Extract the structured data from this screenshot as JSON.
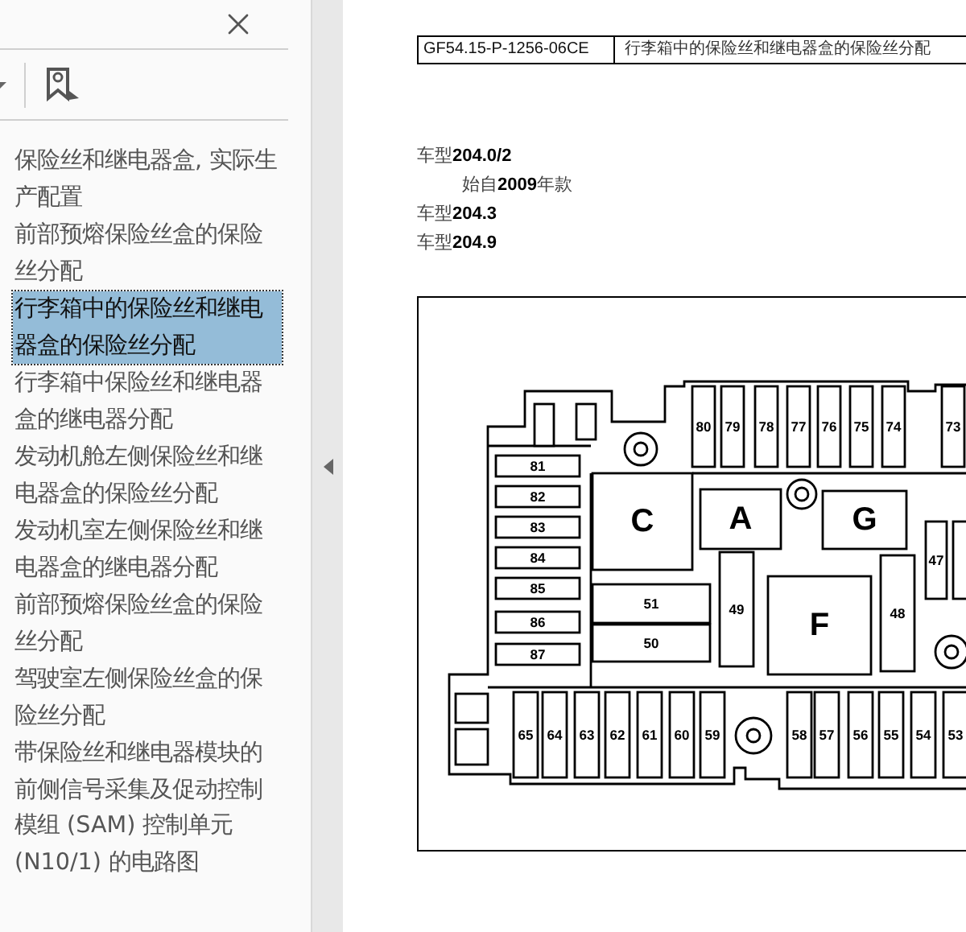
{
  "sidebar": {
    "items": [
      {
        "text": "保险丝和继电器盒, 实际生产配置",
        "selected": false
      },
      {
        "text": "前部预熔保险丝盒的保险丝分配",
        "selected": false
      },
      {
        "text": "行李箱中的保险丝和继电器盒的保险丝分配",
        "selected": true
      },
      {
        "text": "行李箱中保险丝和继电器盒的继电器分配",
        "selected": false
      },
      {
        "text": "发动机舱左侧保险丝和继电器盒的保险丝分配",
        "selected": false
      },
      {
        "text": "发动机室左侧保险丝和继电器盒的继电器分配",
        "selected": false
      },
      {
        "text": "前部预熔保险丝盒的保险丝分配",
        "selected": false
      },
      {
        "text": "驾驶室左侧保险丝盒的保险丝分配",
        "selected": false
      },
      {
        "text": "带保险丝和继电器模块的前侧信号采集及促动控制模组 (SAM) 控制单元 (N10/1) 的电路图",
        "selected": false
      }
    ]
  },
  "document": {
    "header": {
      "code": "GF54.15-P-1256-06CE",
      "title": "行李箱中的保险丝和继电器盒的保险丝分配"
    },
    "models": [
      {
        "text": "车型**204.0/2**",
        "kind": "model"
      },
      {
        "text": "始自**2009**年款",
        "kind": "year"
      },
      {
        "text": "车型**204.3**",
        "kind": "model"
      },
      {
        "text": "车型**204.9**",
        "kind": "model"
      }
    ],
    "diagram_labels": [
      "80",
      "79",
      "78",
      "77",
      "76",
      "75",
      "74",
      "73",
      "81",
      "C",
      "A",
      "G",
      "47",
      "82",
      "83",
      "84",
      "85",
      "51",
      "49",
      "F",
      "48",
      "86",
      "50",
      "87",
      "65",
      "64",
      "63",
      "62",
      "61",
      "60",
      "59",
      "58",
      "57",
      "56",
      "55",
      "54",
      "53"
    ]
  }
}
